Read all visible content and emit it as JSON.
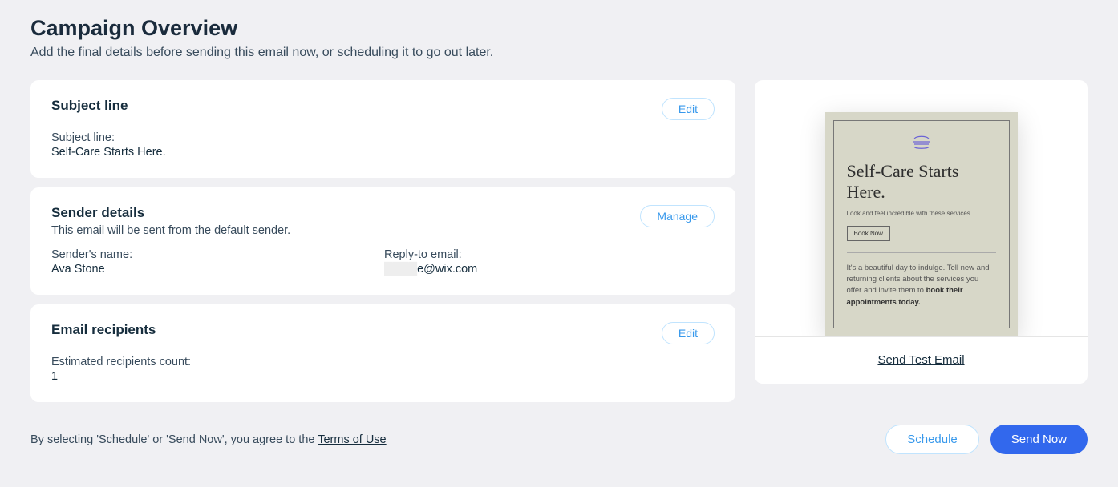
{
  "header": {
    "title": "Campaign Overview",
    "subtitle": "Add the final details before sending this email now, or scheduling it to go out later."
  },
  "subject_card": {
    "title": "Subject line",
    "edit_label": "Edit",
    "field_label": "Subject line:",
    "field_value": "Self-Care Starts Here."
  },
  "sender_card": {
    "title": "Sender details",
    "subtitle": "This email will be sent from the default sender.",
    "manage_label": "Manage",
    "name_label": "Sender's name:",
    "name_value": "Ava Stone",
    "reply_label": "Reply-to email:",
    "reply_value_masked": "████",
    "reply_value_suffix": "e@wix.com"
  },
  "recipients_card": {
    "title": "Email recipients",
    "edit_label": "Edit",
    "count_label": "Estimated recipients count:",
    "count_value": "1"
  },
  "preview": {
    "heading": "Self-Care Starts Here.",
    "subtitle": "Look and feel incredible with these services.",
    "book_label": "Book Now",
    "body_prefix": "It's a beautiful day to indulge. Tell new and returning clients about the services you offer and invite them to ",
    "body_bold": "book their appointments today.",
    "send_test_label": "Send Test Email"
  },
  "footer": {
    "terms_prefix": "By selecting 'Schedule' or 'Send Now', you agree to the ",
    "terms_link": "Terms of Use",
    "schedule_label": "Schedule",
    "send_label": "Send Now"
  }
}
